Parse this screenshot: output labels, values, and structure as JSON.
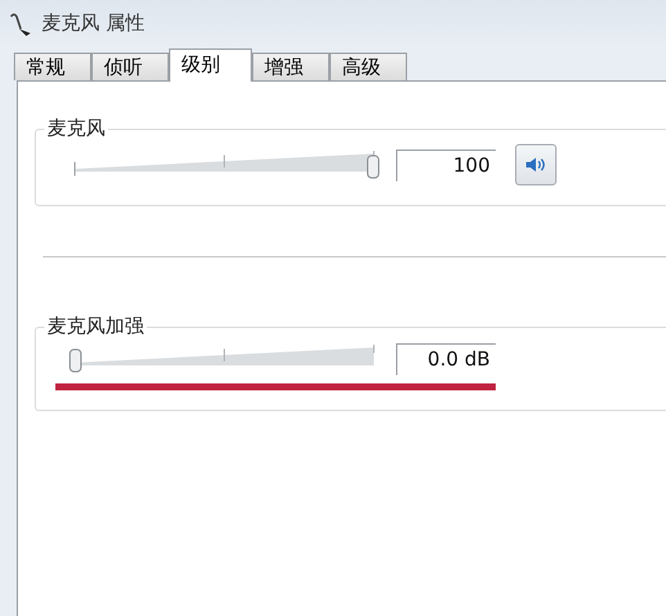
{
  "window": {
    "title": "麦克风 属性"
  },
  "tabs": [
    {
      "label": "常规",
      "selected": false
    },
    {
      "label": "侦听",
      "selected": false
    },
    {
      "label": "级别",
      "selected": true
    },
    {
      "label": "增强",
      "selected": false
    },
    {
      "label": "高级",
      "selected": false
    }
  ],
  "groups": [
    {
      "title": "麦克风",
      "level": 1,
      "value": "100",
      "kind": "volume"
    },
    {
      "title": "麦克风加强",
      "level": 0,
      "value": "0.0 dB",
      "kind": "boost"
    }
  ]
}
